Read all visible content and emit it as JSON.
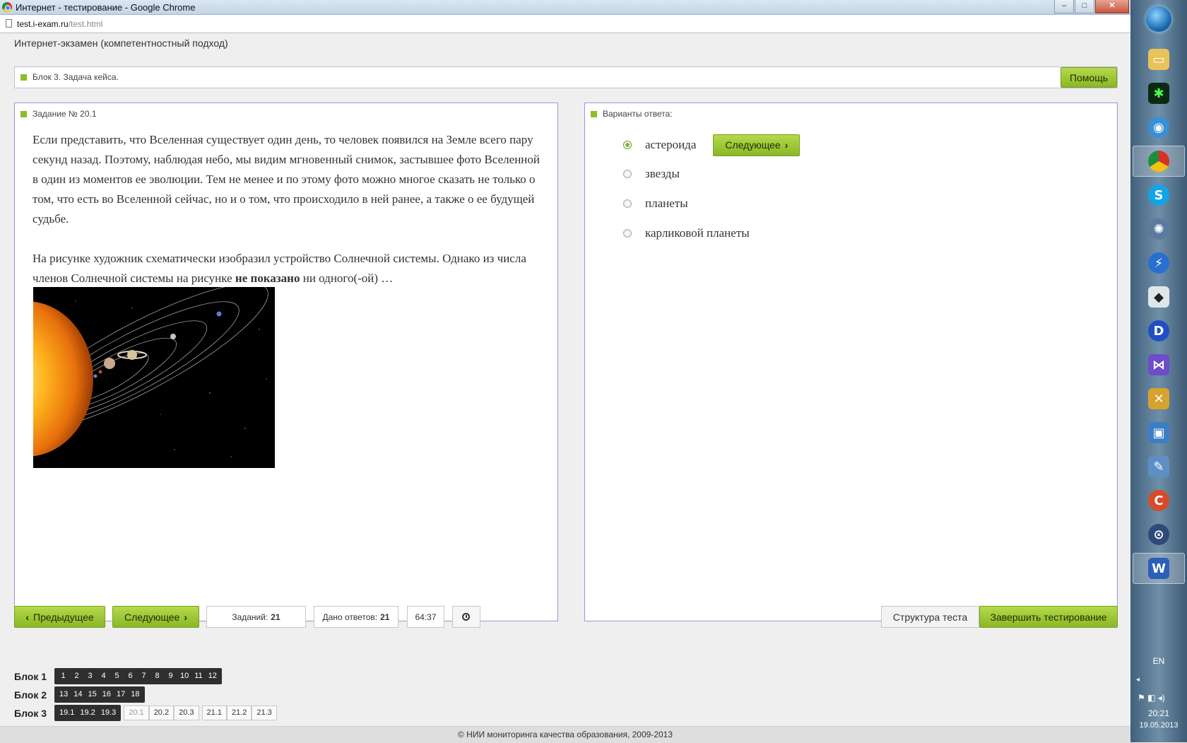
{
  "window": {
    "title": "Интернет - тестирование - Google Chrome",
    "min_label": "–",
    "max_label": "□",
    "close_label": "✕"
  },
  "address": {
    "host": "test.i-exam.ru",
    "path": "/test.html"
  },
  "app": {
    "title": "Интернет-экзамен (компетентностный подход)"
  },
  "block_header": {
    "label": "Блок 3. Задача кейса.",
    "help_label": "Помощь"
  },
  "task": {
    "label": "Задание № 20.1",
    "paragraph1": "Если представить, что Вселенная существует один день, то человек появился на Земле всего пару секунд назад. Поэтому, наблюдая небо, мы видим мгновенный снимок, застывшее фото Вселенной в один из моментов ее эволюции. Тем не менее и по этому фото можно многое сказать не только о том, что есть во Вселенной сейчас, но и о том, что происходило в ней ранее, а также о ее будущей судьбе.",
    "question_before": "На рисунке художник схематически изобразил устройство Солнечной системы. Однако из числа членов Солнечной системы на рисунке ",
    "question_bold": "не показано",
    "question_after": " ни одного(-ой) …"
  },
  "answers": {
    "label": "Варианты ответа:",
    "next_label": "Следующее",
    "options": [
      {
        "label": "астероида",
        "selected": true
      },
      {
        "label": "звезды",
        "selected": false
      },
      {
        "label": "планеты",
        "selected": false
      },
      {
        "label": "карликовой планеты",
        "selected": false
      }
    ]
  },
  "bottom": {
    "prev_label": "Предыдущее",
    "next_label": "Следующее",
    "tasks_label": "Заданий:",
    "tasks_value": "21",
    "answered_label": "Дано ответов:",
    "answered_value": "21",
    "timer": "64:37",
    "structure_label": "Структура теста",
    "finish_label": "Завершить тестирование"
  },
  "blocks": [
    {
      "label": "Блок 1",
      "items": [
        "1",
        "2",
        "3",
        "4",
        "5",
        "6",
        "7",
        "8",
        "9",
        "10",
        "11",
        "12"
      ]
    },
    {
      "label": "Блок 2",
      "items": [
        "13",
        "14",
        "15",
        "16",
        "17",
        "18"
      ]
    },
    {
      "label": "Блок 3",
      "items": [
        "19.1",
        "19.2",
        "19.3"
      ],
      "boxes": [
        "20.1",
        "20.2",
        "20.3",
        "21.1",
        "21.2",
        "21.3"
      ]
    }
  ],
  "footer": "© НИИ мониторинга качества образования, 2009-2013",
  "taskbar": {
    "lang": "EN",
    "time": "20:21",
    "date": "19.05.2013",
    "icons": [
      "folder-icon",
      "matrix-icon",
      "network-icon",
      "chrome-icon",
      "skype-icon",
      "chromium-icon",
      "flash-icon",
      "wolf-icon",
      "daemon-tools-icon",
      "visual-studio-icon",
      "tools-icon",
      "network-monitor-icon",
      "settings-icon",
      "ccleaner-icon",
      "lock-icon",
      "word-icon"
    ]
  }
}
